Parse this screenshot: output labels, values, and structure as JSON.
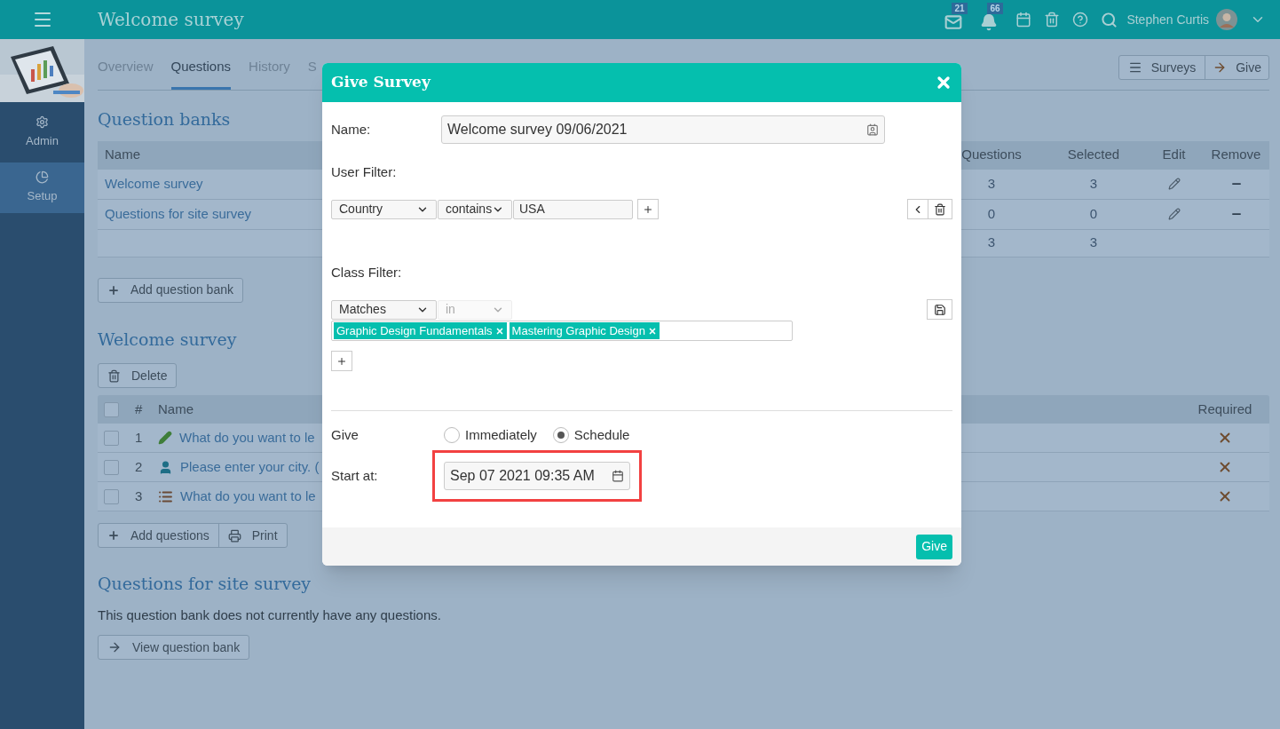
{
  "header": {
    "title": "Welcome survey",
    "mail_count": "21",
    "notification_count": "66",
    "user_name": "Stephen Curtis"
  },
  "sidebar": {
    "items": [
      {
        "label": "Admin",
        "kind": "admin",
        "selected": false
      },
      {
        "label": "Setup",
        "kind": "setup",
        "selected": true
      }
    ]
  },
  "tabs": [
    {
      "label": "Overview",
      "selected": false
    },
    {
      "label": "Questions",
      "selected": true
    },
    {
      "label": "History",
      "selected": false
    },
    {
      "label": "S",
      "selected": false
    }
  ],
  "toolbar": {
    "surveys_button": "Surveys",
    "give_button": "Give"
  },
  "question_banks": {
    "title": "Question banks",
    "columns": [
      "Name",
      "Questions",
      "Selected",
      "Edit",
      "Remove"
    ],
    "rows": [
      {
        "name": "Welcome survey",
        "questions": "3",
        "selected": "3"
      },
      {
        "name": "Questions for site survey",
        "questions": "0",
        "selected": "0"
      }
    ],
    "total": {
      "questions": "3",
      "selected": "3"
    },
    "add_button": "Add question bank"
  },
  "questions_section": {
    "title": "Welcome survey",
    "delete_button": "Delete",
    "select_all_checked": false,
    "columns": [
      "#",
      "Name",
      "Required"
    ],
    "rows": [
      {
        "number": "1",
        "kind": "text",
        "name": "What do you want to le",
        "checked": false,
        "required": false
      },
      {
        "number": "2",
        "kind": "profile",
        "name": "Please enter your city. (",
        "checked": false,
        "required": false
      },
      {
        "number": "3",
        "kind": "choice",
        "name": "What do you want to le",
        "checked": false,
        "required": false
      }
    ],
    "add_button": "Add questions",
    "print_button": "Print"
  },
  "empty_section": {
    "title": "Questions for site survey",
    "message": "This question bank does not currently have any questions.",
    "view_button": "View question bank"
  },
  "dialog": {
    "title": "Give Survey",
    "name_label": "Name:",
    "name_value": "Welcome survey 09/06/2021",
    "user_filter_label": "User Filter:",
    "user_filter": {
      "field": "Country",
      "operator": "contains",
      "value": "USA"
    },
    "class_filter_label": "Class Filter:",
    "class_filter": {
      "mode": "Matches",
      "operator": "in",
      "operator_disabled": true,
      "tags": [
        "Graphic Design Fundamentals",
        "Mastering Graphic Design"
      ]
    },
    "give_label": "Give",
    "give_options": [
      {
        "label": "Immediately",
        "selected": false
      },
      {
        "label": "Schedule",
        "selected": true
      }
    ],
    "start_label": "Start at:",
    "start_value": "Sep 07 2021 09:35 AM",
    "start_highlighted": true,
    "submit_button": "Give"
  }
}
